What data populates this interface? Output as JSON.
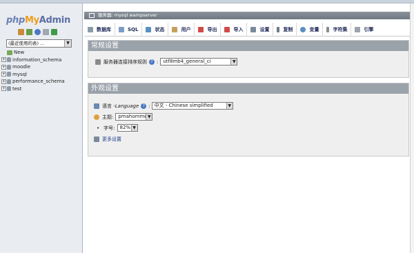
{
  "nav": {
    "logo": {
      "php": "php",
      "my": "My",
      "admin": "Admin"
    },
    "icons": [
      "home-icon",
      "exit-icon",
      "help-icon",
      "docs-icon",
      "reload-icon"
    ],
    "db_select": {
      "value": "(最近使用的表) ..."
    },
    "tree": {
      "new_label": "New",
      "databases": [
        "information_schema",
        "moodle",
        "mysql",
        "performance_schema",
        "test"
      ]
    }
  },
  "main": {
    "server_bar": {
      "label": "服务器: mysql wampserver"
    },
    "tabs": [
      "数据库",
      "SQL",
      "状态",
      "用户",
      "导出",
      "导入",
      "设置",
      "复制",
      "变量",
      "字符集",
      "引擎"
    ],
    "general_settings": {
      "title": "常规设置",
      "collation_label": "服务器连接排序规则",
      "collation_value": "utf8mb4_general_ci"
    },
    "appearance_settings": {
      "title": "外观设置",
      "language_label": "语言 - ",
      "language_label_en": "Language",
      "language_value": "中文 - Chinese simplified",
      "theme_label": "主题:",
      "theme_value": "pmahomme",
      "font_size_label": "字号:",
      "font_size_value": "82%",
      "more_settings": "更多设置"
    }
  },
  "colors": {
    "accent": "#f19c1b",
    "header_gray": "#9aa2aa",
    "link": "#23408e"
  }
}
